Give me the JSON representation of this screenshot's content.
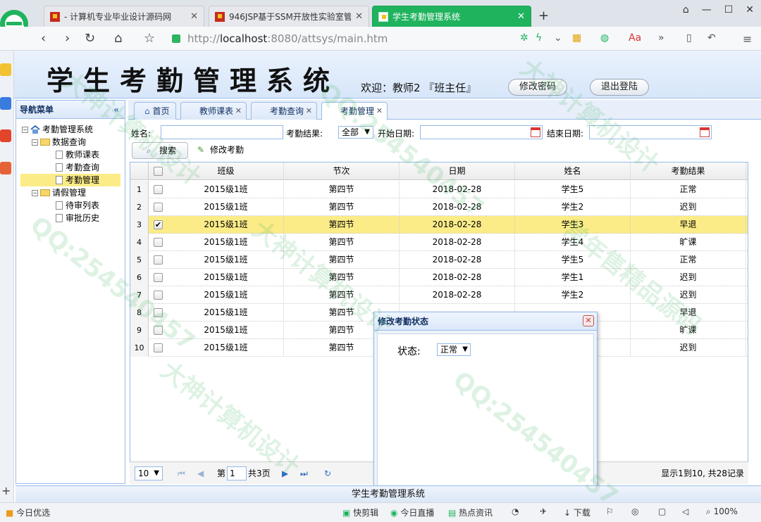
{
  "browser": {
    "tabs": [
      {
        "title": "- 计算机专业毕业设计源码网",
        "active": false
      },
      {
        "title": "946JSP基于SSM开放性实验室管",
        "active": false
      },
      {
        "title": "学生考勤管理系统",
        "active": true
      }
    ],
    "url_scheme": "http://",
    "url_host": "localhost",
    "url_path": ":8080/attsys/main.htm",
    "zoom": "100%"
  },
  "header": {
    "system_name": "学生考勤管理系统",
    "welcome": "欢迎：教师2 『班主任』",
    "change_password_label": "修改密码",
    "logout_label": "退出登陆"
  },
  "nav": {
    "title": "导航菜单",
    "root": "考勤管理系统",
    "groups": [
      {
        "label": "数据查询",
        "items": [
          "教师课表",
          "考勤查询",
          "考勤管理"
        ]
      },
      {
        "label": "请假管理",
        "items": [
          "待审列表",
          "审批历史"
        ]
      }
    ],
    "selected": "考勤管理"
  },
  "page_tabs": [
    {
      "label": "首页",
      "closable": false
    },
    {
      "label": "教师课表",
      "closable": true
    },
    {
      "label": "考勤查询",
      "closable": true
    },
    {
      "label": "考勤管理",
      "closable": true,
      "active": true
    }
  ],
  "search": {
    "name_label": "姓名:",
    "result_label": "考勤结果:",
    "result_value": "全部",
    "start_label": "开始日期:",
    "end_label": "结束日期:",
    "search_button": "搜索",
    "edit_button": "修改考勤"
  },
  "grid": {
    "columns": [
      "班级",
      "节次",
      "日期",
      "姓名",
      "考勤结果"
    ],
    "rows": [
      {
        "n": "1",
        "checked": false,
        "cls": "2015级1班",
        "period": "第四节",
        "date": "2018-02-28",
        "name": "学生5",
        "result": "正常"
      },
      {
        "n": "2",
        "checked": false,
        "cls": "2015级1班",
        "period": "第四节",
        "date": "2018-02-28",
        "name": "学生2",
        "result": "迟到"
      },
      {
        "n": "3",
        "checked": true,
        "cls": "2015级1班",
        "period": "第四节",
        "date": "2018-02-28",
        "name": "学生3",
        "result": "早退"
      },
      {
        "n": "4",
        "checked": false,
        "cls": "2015级1班",
        "period": "第四节",
        "date": "2018-02-28",
        "name": "学生4",
        "result": "旷课"
      },
      {
        "n": "5",
        "checked": false,
        "cls": "2015级1班",
        "period": "第四节",
        "date": "2018-02-28",
        "name": "学生5",
        "result": "正常"
      },
      {
        "n": "6",
        "checked": false,
        "cls": "2015级1班",
        "period": "第四节",
        "date": "2018-02-28",
        "name": "学生1",
        "result": "迟到"
      },
      {
        "n": "7",
        "checked": false,
        "cls": "2015级1班",
        "period": "第四节",
        "date": "2018-02-28",
        "name": "学生2",
        "result": "迟到"
      },
      {
        "n": "8",
        "checked": false,
        "cls": "2015级1班",
        "period": "第四节",
        "date": "",
        "name": "",
        "result": "早退"
      },
      {
        "n": "9",
        "checked": false,
        "cls": "2015级1班",
        "period": "第四节",
        "date": "",
        "name": "",
        "result": "旷课"
      },
      {
        "n": "10",
        "checked": false,
        "cls": "2015级1班",
        "period": "第四节",
        "date": "",
        "name": "",
        "result": "迟到"
      }
    ]
  },
  "pager": {
    "page_size": "10",
    "page_prefix": "第",
    "page": "1",
    "page_suffix": "共3页",
    "summary": "显示1到10, 共28记录"
  },
  "dialog": {
    "title": "修改考勤状态",
    "status_label": "状态:",
    "status_value": "正常"
  },
  "footer": {
    "text": "学生考勤管理系统"
  },
  "statusbar": {
    "left": "今日优选",
    "items": [
      "快剪辑",
      "今日直播",
      "热点资讯",
      "下载"
    ]
  },
  "watermark": {
    "qq": "QQ:254540457",
    "slogan1": "大神计算机设计",
    "slogan2": "常年售精品源码"
  },
  "colors": {
    "active_tab": "#1fb35e",
    "row_selected": "#fbec88",
    "panel_border": "#99bbe8"
  }
}
